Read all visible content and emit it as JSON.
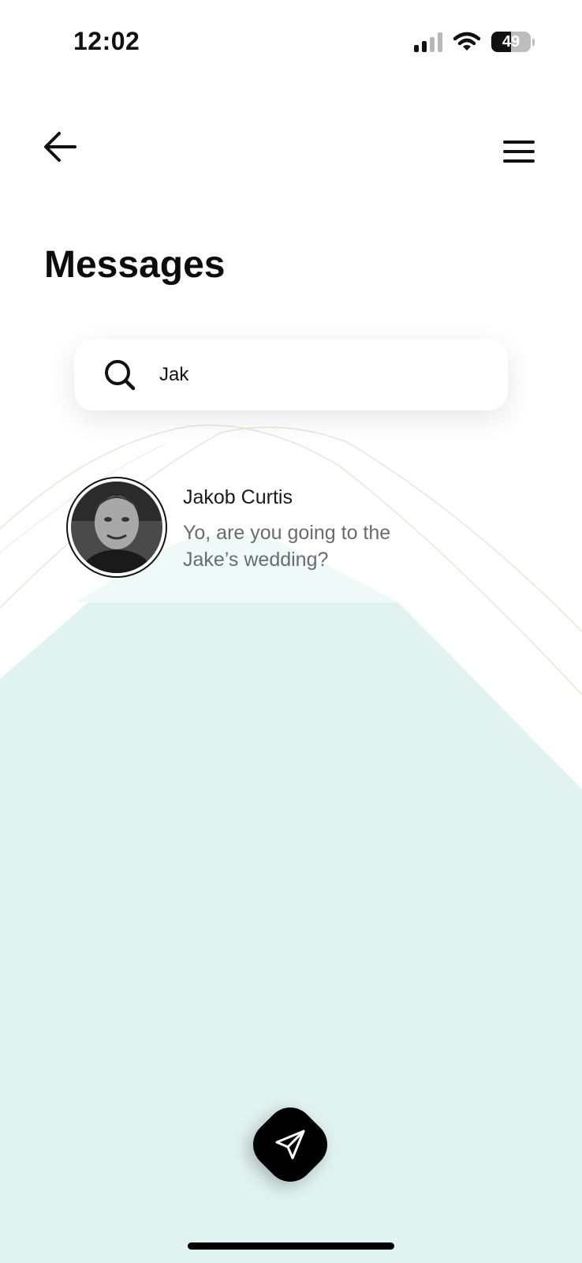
{
  "status_bar": {
    "time": "12:02",
    "battery_percent": "49",
    "battery_level": 0.49,
    "signal_bars_active": 2,
    "signal_bars_total": 4,
    "icons": [
      "signal-icon",
      "wifi-icon",
      "battery-icon"
    ]
  },
  "header": {
    "back_icon": "arrow-left-icon",
    "menu_icon": "hamburger-menu-icon"
  },
  "page": {
    "title": "Messages"
  },
  "search": {
    "icon": "search-icon",
    "value": "Jak",
    "placeholder": ""
  },
  "conversations": [
    {
      "name": "Jakob Curtis",
      "preview": "Yo, are you going to the Jake’s wedding?",
      "avatar": "grayscale-photo"
    }
  ],
  "fab": {
    "icon": "send-icon"
  },
  "colors": {
    "background": "#ffffff",
    "accent_panel": "#e0f3f1",
    "accent_panel_light": "#eef9f8",
    "text_primary": "#111111",
    "text_secondary": "#6b6b6b",
    "fab": "#000000"
  }
}
